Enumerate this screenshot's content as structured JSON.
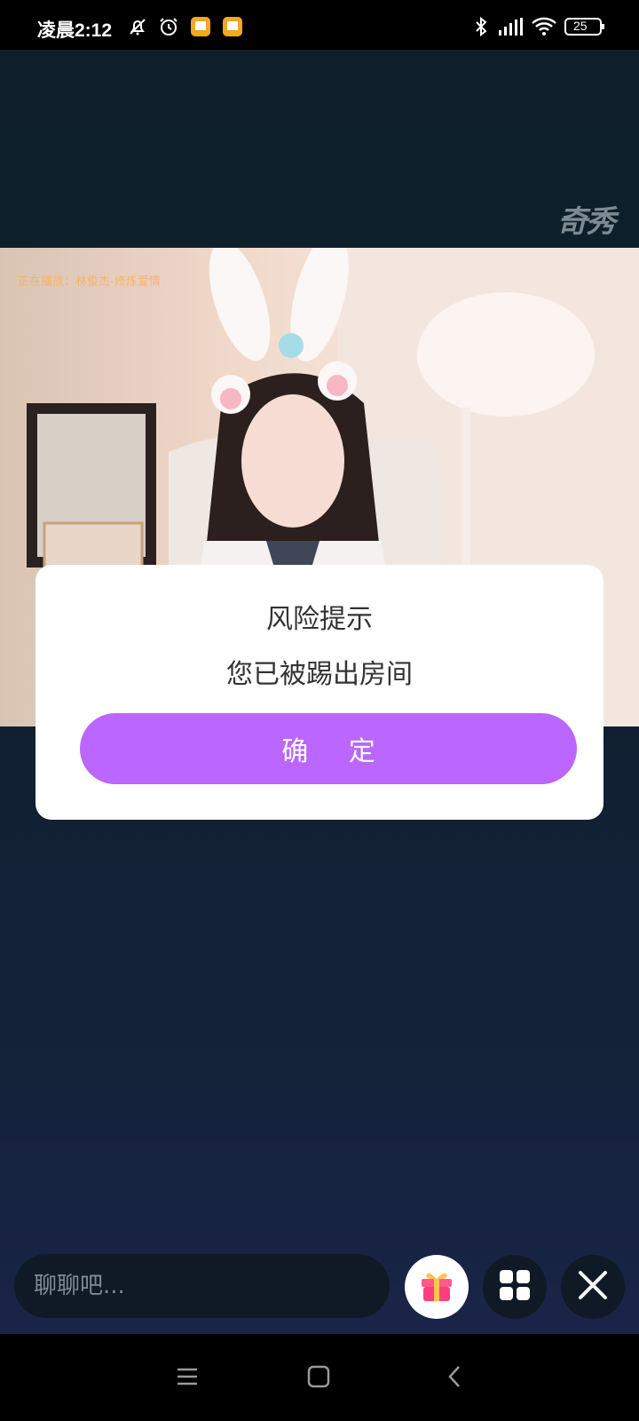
{
  "status_bar": {
    "time": "凌晨2:12",
    "icons_left": [
      "mute-bell-icon",
      "alarm-icon",
      "notification-app-icon",
      "notification-app-icon"
    ],
    "icons_right": [
      "bluetooth-icon",
      "signal-icon",
      "wifi-icon",
      "battery-icon"
    ],
    "battery_level": "25"
  },
  "watermark": "奇秀",
  "player": {
    "now_playing": "正在播放：林俊杰-修炼爱情"
  },
  "dialog": {
    "title": "风险提示",
    "message": "您已被踢出房间",
    "confirm_label": "确 定",
    "confirm_color": "#bb66ff"
  },
  "bottom_bar": {
    "chat_placeholder": "聊聊吧...",
    "gift_icon": "gift-icon",
    "grid_icon": "grid-icon",
    "close_icon": "close-icon"
  },
  "nav_bar": {
    "icons": [
      "menu-icon",
      "home-icon",
      "back-icon"
    ]
  }
}
